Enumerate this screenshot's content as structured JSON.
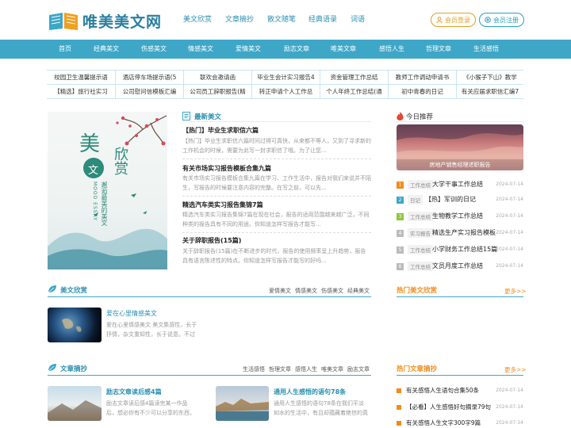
{
  "header": {
    "site_name": "唯美美文网",
    "top_links": [
      "美文欣赏",
      "文章摘抄",
      "散文随笔",
      "经典语录",
      "词语"
    ],
    "login": "会员登录",
    "register": "会员注册"
  },
  "nav": [
    "首页",
    "经典美文",
    "伤感美文",
    "情感美文",
    "爱情美文",
    "励志文章",
    "唯美文章",
    "感悟人生",
    "哲理文章",
    "生活感悟"
  ],
  "link_rows": [
    [
      "校园卫生温馨提示语",
      "酒店停车场提示语(5",
      "联欢会邀请函",
      "毕业生会计实习报告4",
      "资金管理工作总结",
      "教师工作调动申请书",
      "《小猴子下山》教学"
    ],
    [
      "【精选】旅行社实习",
      "公司慰问信模板汇编",
      "公司员工辞职报告(精",
      "转正申请个人工作总",
      "个人年终工作总结(通",
      "初中青春的日记",
      "有关应届求职信汇编7"
    ]
  ],
  "featured": {
    "img_title": "美文欣赏",
    "img_sub": "MOOD ESSAY",
    "img_vert": "邂逅最美的美文"
  },
  "latest": {
    "title": "最新美文",
    "articles": [
      {
        "title": "【热门】毕业生求职信六篇",
        "desc": "【热门】毕业生求职信六篇时间过得可真快，从来都不等人，又到了寻求新的工作机会的时候，需要为此写一封求职信了哦。为了让您..."
      },
      {
        "title": "有关市场实习报告模板合集九篇",
        "desc": "有关市场实习报告模板合集九篇在学习、工作生活中，报告对我们来说并不陌生，写报告的时候要注意内容的完整。在写之前，可以先..."
      },
      {
        "title": "精选汽车类实习报告集锦7篇",
        "desc": "精选汽车类实习报告集锦7篇在现在社会，报告的适用范围越来越广泛，不同种类的报告具有不同的用途。你知道怎样写报告才能写..."
      },
      {
        "title": "关于辞职报告(15篇)",
        "desc": "关于辞职报告(15篇)在不断进步的时代，报告的使用频率呈上升趋势，报告具有语言陈述性的特点。你知道怎样写报告才能写的好吗..."
      }
    ]
  },
  "today": {
    "title": "今日推荐",
    "img_caption": "房地产销售经理述职报告",
    "items": [
      {
        "num": "1",
        "tag": "工作总结",
        "text": "大学干事工作总结",
        "date": "2024-07-14"
      },
      {
        "num": "2",
        "tag": "日记",
        "text": "【热】军训的日记",
        "date": "2024-07-14"
      },
      {
        "num": "3",
        "tag": "工作总结",
        "text": "生物教学工作总结",
        "date": "2024-07-14"
      },
      {
        "num": "4",
        "tag": "实习报告",
        "text": "精选生产实习报告模板",
        "date": "2024-07-14"
      },
      {
        "num": "5",
        "tag": "工作总结",
        "text": "小学财务工作总结15篇",
        "date": "2024-07-14"
      },
      {
        "num": "6",
        "tag": "工作总结",
        "text": "文员月度工作总结",
        "date": "2024-07-14"
      }
    ]
  },
  "appreciate": {
    "title": "美文欣赏",
    "sublinks": [
      "爱情美文",
      "情感美文",
      "伤感美文",
      "经典美文"
    ],
    "article_title": "爱在心里情感美文",
    "article_desc": "爱在心里情感美文 美文集感性，长于抒情，杂文重知性，长于说意。不过",
    "hot_title": "热门美文欣赏",
    "more": "更多>>"
  },
  "excerpt": {
    "title": "文章摘抄",
    "sublinks": [
      "生活感悟",
      "哲理文章",
      "感悟人生",
      "唯美文章",
      "励志文章"
    ],
    "articles": [
      {
        "title": "励志文章读后感4篇",
        "desc": "励志文章读后感4篇读完某一作品后，想必你有不少可以分享的东西，是时"
      },
      {
        "title": "通用人生感悟的语句78条",
        "desc": "通用人生感悟的语句78条在我们平淡如水的生活中，有且却蕴藏着绝世的真"
      }
    ],
    "hot_title": "热门文章摘抄",
    "more": "更多>>",
    "hot_items": [
      {
        "text": "有关感悟人生语句合集50条",
        "date": "2024-07-14"
      },
      {
        "text": "【必看】人生感悟好句摘录79句",
        "date": "2024-07-14"
      },
      {
        "text": "有关感悟人生文字300字9篇",
        "date": "2024-07-14"
      }
    ]
  },
  "colors": {
    "accent": "#3ea7c7",
    "orange": "#f08c1c",
    "link": "#2a8fb0"
  }
}
